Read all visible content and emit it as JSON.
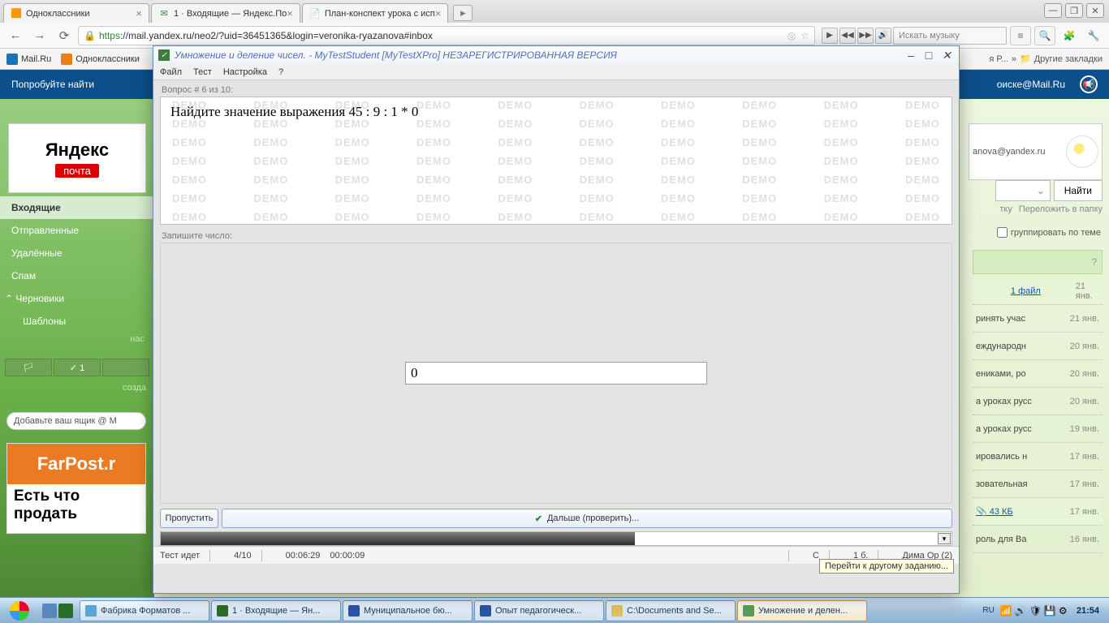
{
  "browser": {
    "tabs": [
      {
        "icon": "🟧",
        "label": "Одноклассники"
      },
      {
        "icon": "✉",
        "label": "1 · Входящие — Яндекс.По"
      },
      {
        "icon": "📄",
        "label": "План-конспект урока с исп"
      }
    ],
    "url_prefix": "https",
    "url_rest": "://mail.yandex.ru/neo2/?uid=36451365&login=veronika-ryazanova#inbox",
    "music_placeholder": "Искать музыку",
    "bookmarks": [
      "Mail.Ru",
      "Одноклассники"
    ],
    "peek_bookmark": "я Р...",
    "other_bookmarks": "Другие закладки"
  },
  "yandex": {
    "try_search": "Попробуйте найти",
    "mail_at": "оиске@Mail.Ru",
    "logo": "Яндекс",
    "pochta": "почта",
    "folders": {
      "inbox": "Входящие",
      "sent": "Отправленные",
      "deleted": "Удалённые",
      "spam": "Спам",
      "drafts": "Черновики",
      "templates": "Шаблоны"
    },
    "nas": "нас",
    "sozda": "созда",
    "check1": "✓ 1",
    "add_box": "Добавьте ваш ящик  @  М",
    "farpost": "FarPost.r",
    "farpost_txt": "Есть что\nпродать",
    "user_mail": "anova@yandex.ru",
    "find": "Найти",
    "bar_links": {
      "a": "тку",
      "b": "Переложить в папку"
    },
    "group": "группировать по теме",
    "items": [
      {
        "label": "1\nфайл",
        "date": "21 янв.",
        "hl": true
      },
      {
        "label": "ринять учас",
        "date": "21 янв."
      },
      {
        "label": "еждународн",
        "date": "20 янв."
      },
      {
        "label": "ениками, ро",
        "date": "20 янв."
      },
      {
        "label": "а уроках русс",
        "date": "20 янв."
      },
      {
        "label": "а уроках русс",
        "date": "19 янв."
      },
      {
        "label": "ировались н",
        "date": "17 янв."
      },
      {
        "label": "зовательная",
        "date": "17 янв."
      },
      {
        "label": "📎 43 КБ",
        "date": "17 янв.",
        "file": true
      },
      {
        "label": "роль для Ва",
        "date": "16 янв."
      }
    ]
  },
  "dlg": {
    "title": "Умножение и деление чисел. - MyTestStudent [MyTestXPro] НЕЗАРЕГИСТРИРОВАННАЯ ВЕРСИЯ",
    "menu": {
      "file": "Файл",
      "test": "Тест",
      "settings": "Настройка",
      "help": "?"
    },
    "q_num": "Вопрос # 6 из 10:",
    "question": "Найдите значение выражения 45 : 9 : 1 * 0",
    "demo": "DEMO",
    "write_label": "Запишите число:",
    "answer": "0",
    "skip": "Пропустить",
    "next": "Дальше (проверить)...",
    "status": {
      "running": "Тест идет",
      "progress": "4/10",
      "t1": "00:06:29",
      "t2": "00:00:09",
      "c": "С",
      "b": "1 б.",
      "user": "Дима Ор (2)"
    },
    "tooltip": "Перейти к другому заданию..."
  },
  "taskbar": {
    "items": [
      {
        "label": "Фабрика Форматов ..."
      },
      {
        "label": "1 · Входящие — Ян..."
      },
      {
        "label": "Муниципальное бю..."
      },
      {
        "label": "Опыт педагогическ..."
      },
      {
        "label": "C:\\Documents and Se..."
      },
      {
        "label": "Умножение и делен...",
        "active": true
      }
    ],
    "lang": "RU",
    "time": "21:54"
  }
}
